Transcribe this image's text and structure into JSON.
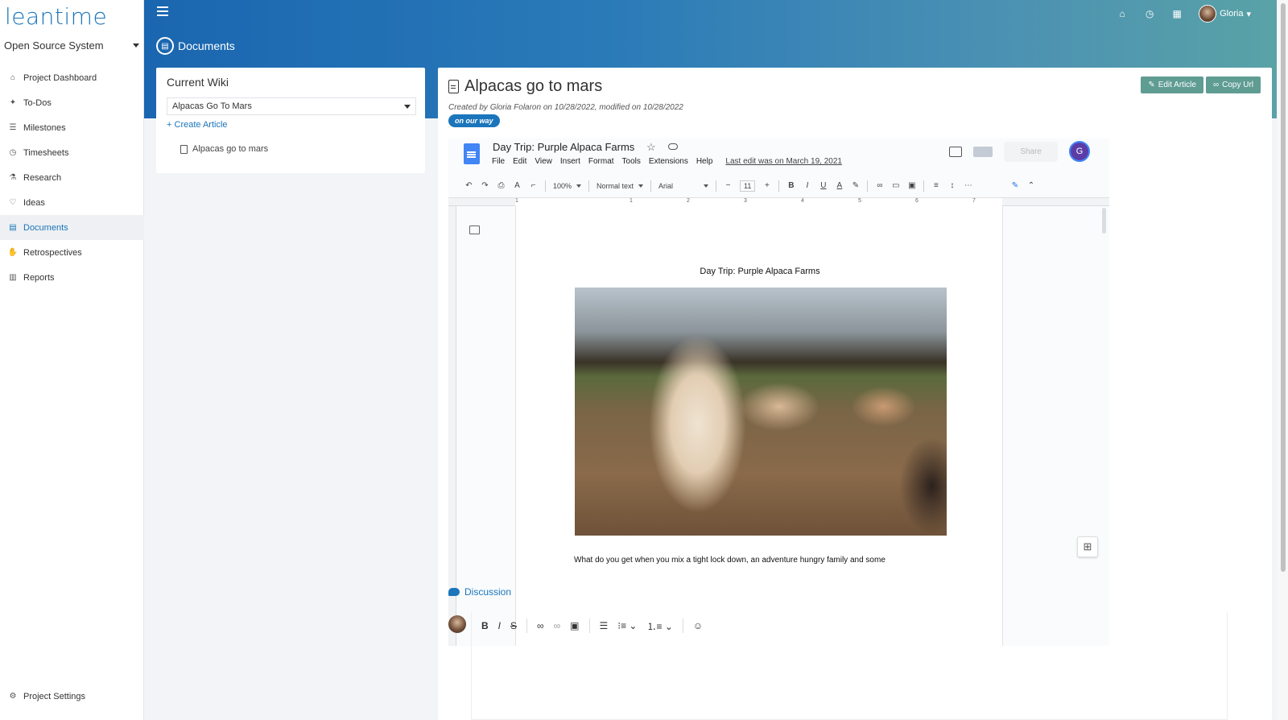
{
  "app": {
    "logo": "leantime",
    "project_selector": "Open Source System"
  },
  "sidebar": {
    "items": [
      {
        "label": "Project Dashboard",
        "icon": "home-icon"
      },
      {
        "label": "To-Dos",
        "icon": "pin-icon"
      },
      {
        "label": "Milestones",
        "icon": "sliders-icon"
      },
      {
        "label": "Timesheets",
        "icon": "clock-icon"
      },
      {
        "label": "Research",
        "icon": "flask-icon"
      },
      {
        "label": "Ideas",
        "icon": "lightbulb-icon"
      },
      {
        "label": "Documents",
        "icon": "book-icon",
        "active": true
      },
      {
        "label": "Retrospectives",
        "icon": "hand-icon"
      },
      {
        "label": "Reports",
        "icon": "chart-icon"
      }
    ],
    "footer": {
      "label": "Project Settings",
      "icon": "gear-icon"
    }
  },
  "header": {
    "page_title": "Documents",
    "user_name": "Gloria",
    "accent": "#1b75bb"
  },
  "wiki": {
    "heading": "Current Wiki",
    "selected_wiki": "Alpacas Go To Mars",
    "create_label": "Create Article",
    "articles": [
      "Alpacas go to mars"
    ]
  },
  "article": {
    "title": "Alpacas go to mars",
    "meta": "Created by Gloria Folaron on 10/28/2022, modified on 10/28/2022",
    "status": "on our way",
    "edit_button": "Edit Article",
    "copy_button": "Copy Url"
  },
  "gdoc": {
    "title": "Day Trip: Purple Alpaca Farms",
    "menus": [
      "File",
      "Edit",
      "View",
      "Insert",
      "Format",
      "Tools",
      "Extensions",
      "Help"
    ],
    "last_edit": "Last edit was on March 19, 2021",
    "share_label": "Share",
    "avatar_initial": "G",
    "zoom": "100%",
    "style": "Normal text",
    "font": "Arial",
    "font_size": "11",
    "page_heading": "Day Trip: Purple Alpaca Farms",
    "body_text": "What do you get when you mix a tight lock down, an adventure hungry family and some",
    "ruler_marks": [
      "1",
      "1",
      "2",
      "3",
      "4",
      "5",
      "6",
      "7"
    ]
  },
  "discussion": {
    "title": "Discussion"
  }
}
